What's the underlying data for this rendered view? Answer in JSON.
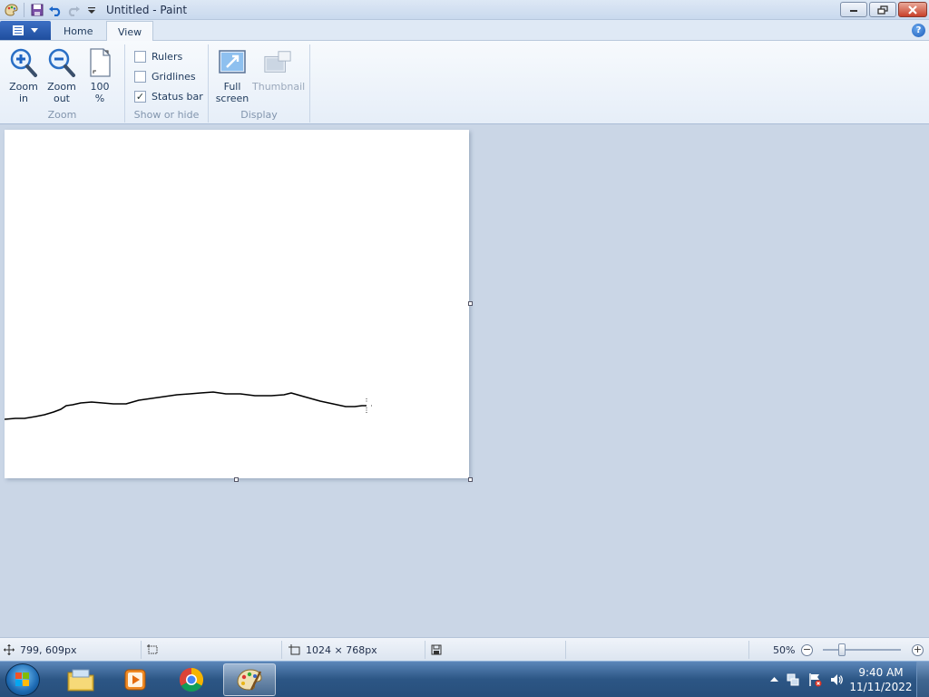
{
  "window": {
    "title": "Untitled - Paint"
  },
  "ribbon": {
    "tabs": {
      "home": "Home",
      "view": "View"
    },
    "zoom_group": {
      "label": "Zoom",
      "zoom_in_l1": "Zoom",
      "zoom_in_l2": "in",
      "zoom_out_l1": "Zoom",
      "zoom_out_l2": "out",
      "hundred_l1": "100",
      "hundred_l2": "%"
    },
    "show_hide_group": {
      "label": "Show or hide",
      "rulers": "Rulers",
      "gridlines": "Gridlines",
      "status_bar": "Status bar",
      "status_bar_check": "✓"
    },
    "display_group": {
      "label": "Display",
      "full_l1": "Full",
      "full_l2": "screen",
      "thumbnail": "Thumbnail"
    }
  },
  "statusbar": {
    "cursor_pos": "799, 609px",
    "image_size": "1024 × 768px",
    "zoom": "50%",
    "zoom_level_percent": 50,
    "minus": "−",
    "plus": "+"
  },
  "taskbar": {
    "time": "9:40 AM",
    "date": "11/11/2022"
  },
  "colors": {
    "accent": "#1f4e9e",
    "workspace": "#cad6e6"
  }
}
